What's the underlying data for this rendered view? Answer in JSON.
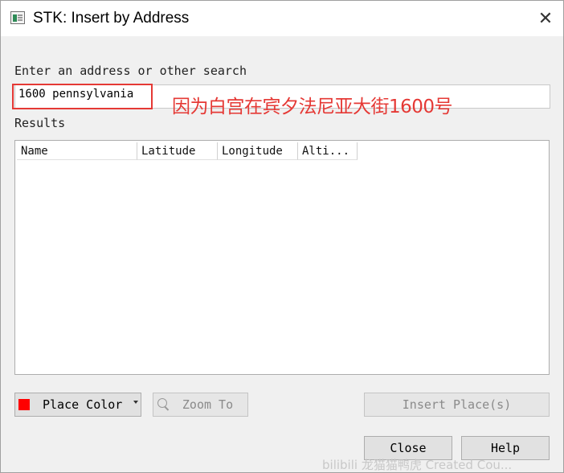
{
  "window": {
    "title": "STK: Insert by Address"
  },
  "search": {
    "label": "Enter an address or other search",
    "value": "1600 pennsylvania",
    "annotation": "因为白宫在宾夕法尼亚大街1600号",
    "annotation_color": "#e53935"
  },
  "results": {
    "label": "Results",
    "columns": [
      "Name",
      "Latitude",
      "Longitude",
      "Alti..."
    ]
  },
  "buttons": {
    "place_color": "Place Color",
    "place_color_value": "#ff0000",
    "zoom_to": "Zoom To",
    "insert_places": "Insert Place(s)",
    "close": "Close",
    "help": "Help"
  },
  "watermark": "bilibili 龙猫猫鸭虎 Created Cou..."
}
